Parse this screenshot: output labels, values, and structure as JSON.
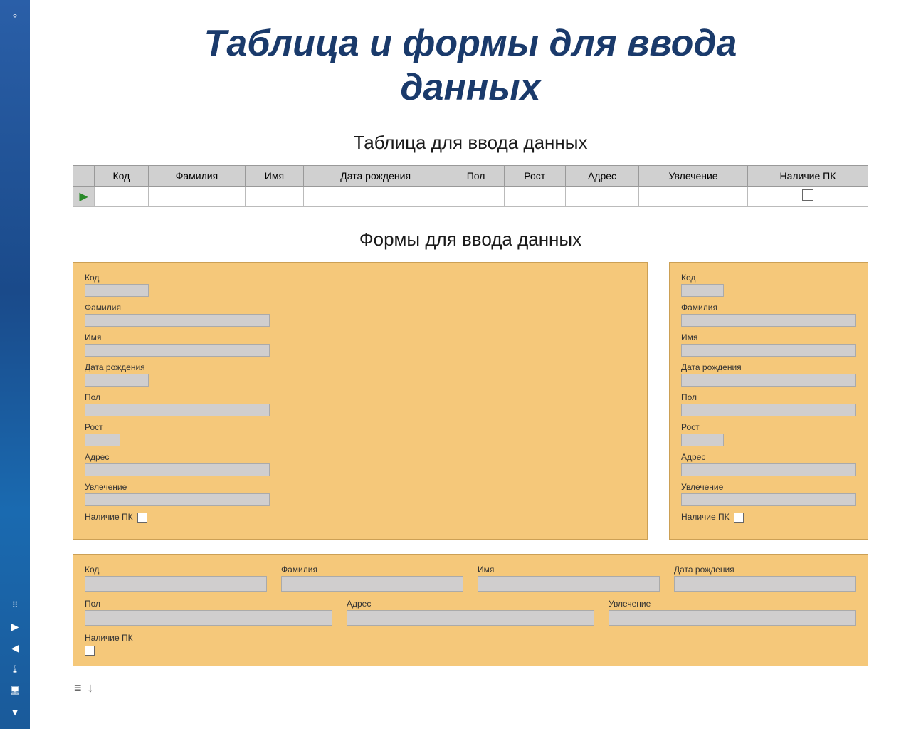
{
  "page": {
    "title_line1": "Таблица и формы для ввода",
    "title_line2": "данных"
  },
  "table_section": {
    "heading": "Таблица для ввода данных",
    "columns": [
      "Код",
      "Фамилия",
      "Имя",
      "Дата рождения",
      "Пол",
      "Рост",
      "Адрес",
      "Увлечение",
      "Наличие ПК"
    ]
  },
  "forms_section": {
    "heading": "Формы для ввода данных"
  },
  "form_left": {
    "fields": [
      {
        "label": "Код",
        "size": "short"
      },
      {
        "label": "Фамилия",
        "size": "long"
      },
      {
        "label": "Имя",
        "size": "long"
      },
      {
        "label": "Дата рождения",
        "size": "short"
      },
      {
        "label": "Пол",
        "size": "long"
      },
      {
        "label": "Рост",
        "size": "tiny"
      },
      {
        "label": "Адрес",
        "size": "long"
      },
      {
        "label": "Увлечение",
        "size": "long"
      },
      {
        "label": "Наличие ПК",
        "size": "checkbox"
      }
    ]
  },
  "form_right": {
    "fields": [
      {
        "label": "Код",
        "size": "short"
      },
      {
        "label": "Фамилия",
        "size": "full"
      },
      {
        "label": "Имя",
        "size": "full"
      },
      {
        "label": "Дата рождения",
        "size": "full"
      },
      {
        "label": "Пол",
        "size": "full"
      },
      {
        "label": "Рост",
        "size": "short"
      },
      {
        "label": "Адрес",
        "size": "full"
      },
      {
        "label": "Увлечение",
        "size": "full"
      },
      {
        "label": "Наличие ПК",
        "size": "checkbox"
      }
    ]
  },
  "form_wide": {
    "row1_fields": [
      "Код",
      "Фамилия",
      "Имя",
      "Дата рождения"
    ],
    "row2_fields": [
      "Пол",
      "Адрес",
      "Увлечение"
    ],
    "row3_label": "Наличие ПК"
  },
  "sidebar": {
    "icons": [
      "grid",
      "arrow-right",
      "arrow-left",
      "thermometer",
      "monitor",
      "arrow-down"
    ]
  }
}
